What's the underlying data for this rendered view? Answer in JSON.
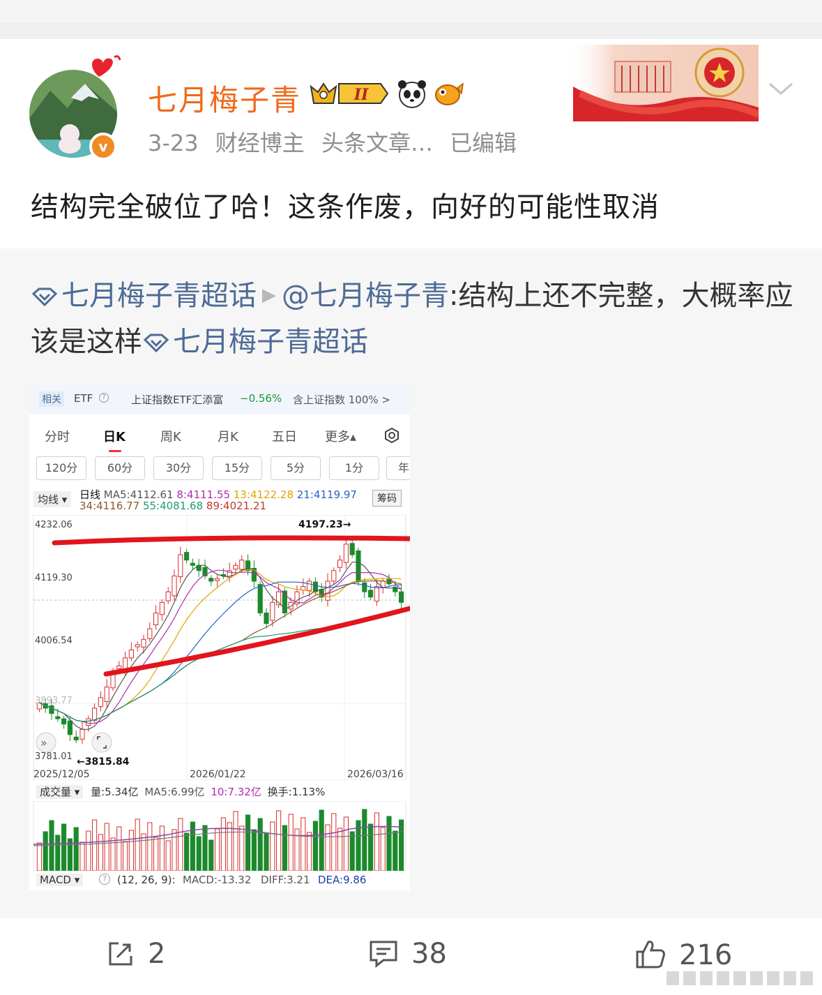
{
  "post": {
    "username": "七月梅子青",
    "date": "3-23",
    "meta_role": "财经博主",
    "meta_extra": "头条文章…",
    "meta_edited": "已编辑",
    "verify_glyph": "v",
    "level_text": "II",
    "text": "结构完全破位了哈！这条作废，向好的可能性取消"
  },
  "repost": {
    "topic1": "七月梅子青超话",
    "mention": "@七月梅子青",
    "body": ":结构上还不完整，大概率应该是这样",
    "topic2": "七月梅子青超话"
  },
  "screenshot": {
    "etf": {
      "tag": "相关",
      "label": "ETF",
      "name": "上证指数ETF汇添富",
      "change": "−0.56%",
      "holds": "含上证指数 100% >"
    },
    "tabs": [
      "分时",
      "日K",
      "周K",
      "月K",
      "五日",
      "更多▴"
    ],
    "minute_buttons": [
      "120分",
      "60分",
      "30分",
      "15分",
      "5分",
      "1分",
      "年"
    ],
    "ma": {
      "selector": "均线 ▾",
      "day_label": "日线",
      "ma5": "MA5:4112.61",
      "ma8": "8:4111.55",
      "ma13": "13:4122.28",
      "ma21": "21:4119.97",
      "ma34": "34:4116.77",
      "ma55": "55:4081.68",
      "ma89": "89:4021.21",
      "chouma": "筹码"
    },
    "price_labels": {
      "top": "4232.06",
      "mid": "4119.30",
      "low": "4006.54",
      "bottom": "3781.01",
      "high_mark": "4197.23→",
      "low_mark": "←3815.84",
      "faded_a": "3893.77"
    },
    "dates": [
      "2025/12/05",
      "2026/01/22",
      "2026/03/16"
    ],
    "volume": {
      "selector": "成交量 ▾",
      "vol": "量:5.34亿",
      "ma5": "MA5:6.99亿",
      "ma10": "10:7.32亿",
      "turnover": "换手:1.13%"
    },
    "macd": {
      "selector": "MACD ▾",
      "params": "(12, 26, 9):",
      "macd": "MACD:-13.32",
      "diff": "DIFF:3.21",
      "dea": "DEA:9.86"
    },
    "colors": {
      "up": "#d62d2d",
      "down": "#1c8a2c",
      "trend_line": "#e2141c"
    },
    "chart_data": {
      "type": "candlestick",
      "x_range": [
        "2025/12/05",
        "2026/03/16"
      ],
      "y_range": [
        3781.01,
        4232.06
      ],
      "annotations": [
        "4197.23",
        "3815.84"
      ],
      "close_series_approx": [
        3890,
        3880,
        3870,
        3860,
        3850,
        3830,
        3820,
        3840,
        3860,
        3880,
        3900,
        3920,
        3950,
        3960,
        3975,
        3990,
        4000,
        4010,
        4030,
        4060,
        4080,
        4100,
        4130,
        4170,
        4160,
        4150,
        4140,
        4130,
        4120,
        4125,
        4130,
        4140,
        4150,
        4160,
        4140,
        4120,
        4060,
        4040,
        4080,
        4100,
        4060,
        4080,
        4100,
        4110,
        4120,
        4100,
        4090,
        4120,
        4140,
        4160,
        4190,
        4170,
        4120,
        4100,
        4090,
        4110,
        4120,
        4115,
        4100,
        4080
      ],
      "trend_lines": [
        "resistance",
        "support"
      ]
    }
  },
  "actions": {
    "repost_count": "2",
    "comment_count": "38",
    "like_count": "216"
  }
}
